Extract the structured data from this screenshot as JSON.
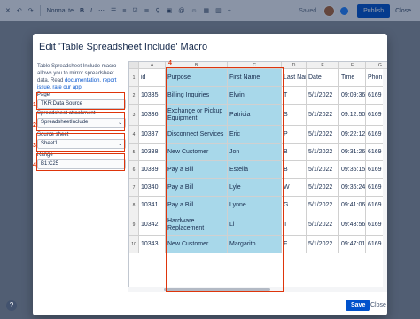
{
  "toolbar": {
    "font": "Normal te",
    "saved": "Saved",
    "publish": "Publish",
    "close": "Close"
  },
  "dialog": {
    "title": "Edit 'Table Spreadsheet Include' Macro",
    "description": "Table Spreadsheet Include macro allows you to mirror spreadsheet data",
    "read": "Read",
    "doc_link": "documentation",
    "report_link": "report issue",
    "rate_link": "rate our app",
    "page_label": "Page",
    "page_value": "TKR:Data Source",
    "attachment_label": "Spreadsheet attachment",
    "attachment_value": "SpreadsheetInclude",
    "sheet_label": "Source sheet",
    "sheet_value": "Sheet1",
    "range_label": "Range",
    "range_value": "B1:C25",
    "save": "Save",
    "close": "Close",
    "markers": [
      "1",
      "2",
      "3",
      "4",
      "4"
    ]
  },
  "grid": {
    "col_letters": [
      "",
      "A",
      "B",
      "C",
      "D",
      "E",
      "F",
      "G"
    ],
    "row_numbers": [
      "1",
      "2",
      "3",
      "4",
      "5",
      "6",
      "7",
      "8",
      "9",
      "10"
    ],
    "header": [
      "id",
      "Purpose",
      "First Name",
      "Last Name",
      "Date",
      "Time",
      "Phon"
    ],
    "rows": [
      [
        "10335",
        "Billing Inquiries",
        "Elwin",
        "T",
        "5/1/2022",
        "09:09:36",
        "6169"
      ],
      [
        "10336",
        "Exchange or Pickup Equipment",
        "Patricia",
        "S",
        "5/1/2022",
        "09:12:50",
        "6169"
      ],
      [
        "10337",
        "Disconnect Services",
        "Eric",
        "P",
        "5/1/2022",
        "09:22:12",
        "6169"
      ],
      [
        "10338",
        "New Customer",
        "Jon",
        "B",
        "5/1/2022",
        "09:31:26",
        "6169"
      ],
      [
        "10339",
        "Pay a Bill",
        "Estella",
        "B",
        "5/1/2022",
        "09:35:15",
        "6169"
      ],
      [
        "10340",
        "Pay a Bill",
        "Lyle",
        "W",
        "5/1/2022",
        "09:36:24",
        "6169"
      ],
      [
        "10341",
        "Pay a Bill",
        "Lynne",
        "G",
        "5/1/2022",
        "09:41:06",
        "6169"
      ],
      [
        "10342",
        "Hardware Replacement",
        "Li",
        "T",
        "5/1/2022",
        "09:43:56",
        "6169"
      ],
      [
        "10343",
        "New Customer",
        "Margarito",
        "F",
        "5/1/2022",
        "09:47:01",
        "6169"
      ]
    ]
  },
  "colors": {
    "accent": "#0052cc",
    "highlight": "#a8d8ea",
    "marker": "#de350b"
  }
}
